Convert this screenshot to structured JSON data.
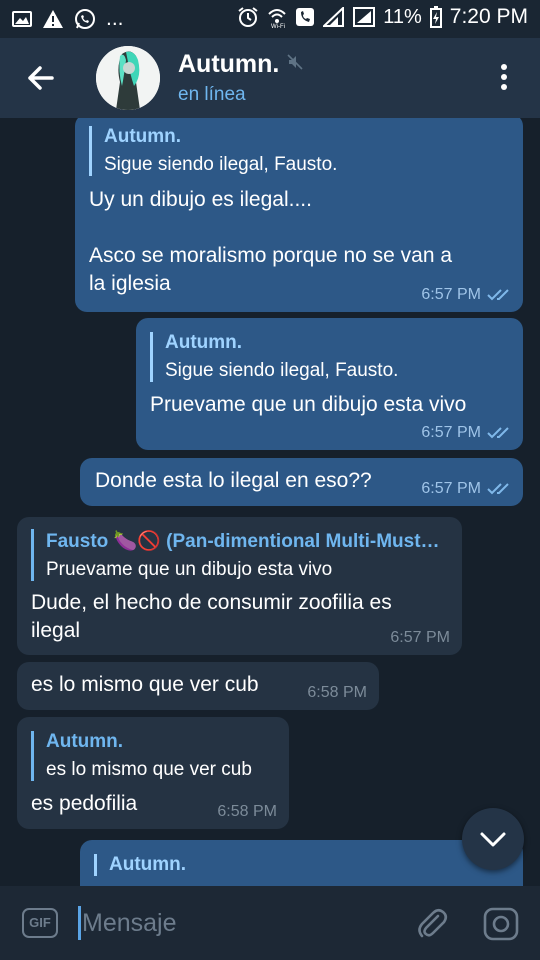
{
  "status_bar": {
    "left_icons": [
      "image-icon",
      "warning-icon",
      "whatsapp-icon",
      "more-notifications"
    ],
    "left_more": "...",
    "battery_percent": "11%",
    "time": "7:20 PM"
  },
  "header": {
    "title": "Autumn.",
    "status": "en línea"
  },
  "messages": [
    {
      "direction": "out",
      "quote_author": "Autumn.",
      "quote_text": "Sigue siendo ilegal, Fausto.",
      "text": "Uy un dibujo es ilegal....\n\nAsco se moralismo porque no se van a\nla iglesia",
      "time": "6:57 PM",
      "read": true
    },
    {
      "direction": "out",
      "quote_author": "Autumn.",
      "quote_text": "Sigue siendo ilegal, Fausto.",
      "text": "Pruevame que un dibujo esta vivo",
      "time": "6:57 PM",
      "read": true
    },
    {
      "direction": "out",
      "text": "Donde esta lo ilegal en eso??",
      "time": "6:57 PM",
      "read": true
    },
    {
      "direction": "in",
      "quote_author": "Fausto 🍆🚫 (Pan-dimentional Multi-Must…",
      "quote_text": "Pruevame que un dibujo esta vivo",
      "text": "Dude, el hecho de consumir zoofilia es\nilegal",
      "time": "6:57 PM"
    },
    {
      "direction": "in",
      "text": "es lo mismo que ver cub",
      "time": "6:58 PM"
    },
    {
      "direction": "in",
      "quote_author": "Autumn.",
      "quote_text": "es lo mismo que ver cub",
      "text": "es pedofilia",
      "time": "6:58 PM"
    },
    {
      "direction": "out",
      "quote_author": "Autumn."
    }
  ],
  "input": {
    "gif_label": "GIF",
    "placeholder": "Mensaje",
    "value": ""
  },
  "colors": {
    "header_bg": "#243447",
    "chat_bg": "#16202b",
    "outgoing_bubble": "#2d5887",
    "incoming_bubble": "#253343",
    "accent": "#6fb6ef"
  }
}
